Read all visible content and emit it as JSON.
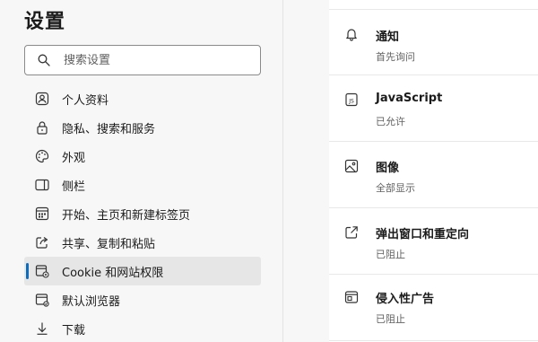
{
  "sidebar": {
    "title": "设置",
    "search": {
      "placeholder": "搜索设置"
    },
    "items": [
      {
        "label": "个人资料",
        "icon": "profile-icon"
      },
      {
        "label": "隐私、搜索和服务",
        "icon": "lock-icon"
      },
      {
        "label": "外观",
        "icon": "palette-icon"
      },
      {
        "label": "侧栏",
        "icon": "sidebar-panel-icon"
      },
      {
        "label": "开始、主页和新建标签页",
        "icon": "home-grid-icon"
      },
      {
        "label": "共享、复制和粘贴",
        "icon": "share-icon"
      },
      {
        "label": "Cookie 和网站权限",
        "icon": "cookie-permissions-icon",
        "active": true
      },
      {
        "label": "默认浏览器",
        "icon": "browser-icon"
      },
      {
        "label": "下载",
        "icon": "download-icon"
      }
    ]
  },
  "permissions": [
    {
      "title": "通知",
      "status": "首先询问",
      "icon": "bell-icon"
    },
    {
      "title": "JavaScript",
      "status": "已允许",
      "icon": "javascript-icon"
    },
    {
      "title": "图像",
      "status": "全部显示",
      "icon": "image-icon"
    },
    {
      "title": "弹出窗口和重定向",
      "status": "已阻止",
      "icon": "popup-icon"
    },
    {
      "title": "侵入性广告",
      "status": "已阻止",
      "icon": "ads-icon"
    }
  ],
  "colors": {
    "accent": "#0f6cbd"
  }
}
